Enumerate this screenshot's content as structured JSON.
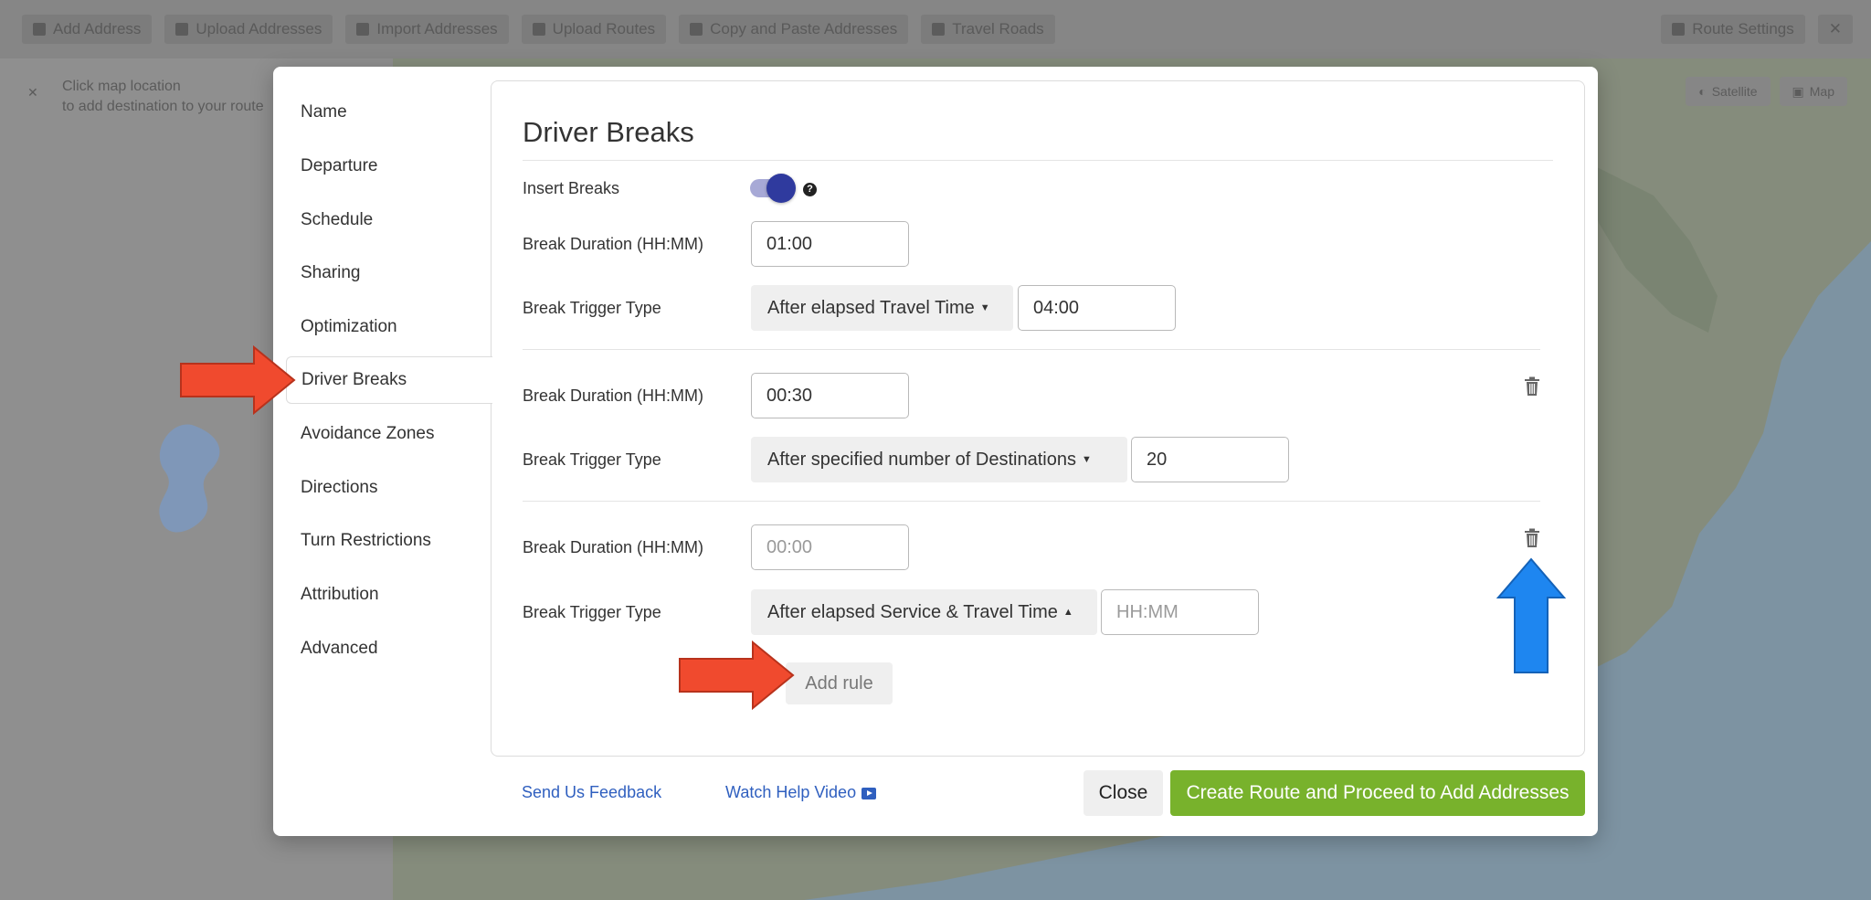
{
  "background": {
    "toolbar_items": [
      "Add Address",
      "Upload Addresses",
      "Import Addresses",
      "Upload Routes",
      "Copy and Paste Addresses",
      "Travel Roads"
    ],
    "toolbar_right": [
      "Route Settings"
    ],
    "hint_line1": "Click map location",
    "hint_line2": "to add destination to your route",
    "map_controls": [
      "Satellite",
      "Map"
    ]
  },
  "nav": {
    "items": [
      {
        "label": "Name"
      },
      {
        "label": "Departure"
      },
      {
        "label": "Schedule"
      },
      {
        "label": "Sharing"
      },
      {
        "label": "Optimization"
      },
      {
        "label": "Driver Breaks"
      },
      {
        "label": "Avoidance Zones"
      },
      {
        "label": "Directions"
      },
      {
        "label": "Turn Restrictions"
      },
      {
        "label": "Attribution"
      },
      {
        "label": "Advanced"
      }
    ],
    "active": "Driver Breaks"
  },
  "panel": {
    "title": "Driver Breaks",
    "insert_breaks_label": "Insert Breaks",
    "insert_breaks_on": true,
    "help_glyph": "?",
    "rules": [
      {
        "duration_label": "Break Duration (HH:MM)",
        "duration_value": "01:00",
        "trigger_label": "Break Trigger Type",
        "trigger_type": "After elapsed Travel Time",
        "trigger_caret": "down",
        "trigger_value": "04:00",
        "trigger_placeholder": ""
      },
      {
        "duration_label": "Break Duration (HH:MM)",
        "duration_value": "00:30",
        "trigger_label": "Break Trigger Type",
        "trigger_type": "After specified number of Destinations",
        "trigger_caret": "down",
        "trigger_value": "20",
        "trigger_placeholder": ""
      },
      {
        "duration_label": "Break Duration (HH:MM)",
        "duration_value": "",
        "duration_placeholder": "00:00",
        "trigger_label": "Break Trigger Type",
        "trigger_type": "After elapsed Service & Travel Time",
        "trigger_caret": "up",
        "trigger_value": "",
        "trigger_placeholder": "HH:MM"
      }
    ],
    "add_rule_label": "Add rule"
  },
  "footer": {
    "feedback_link": "Send Us Feedback",
    "help_video_link": "Watch Help Video",
    "close_label": "Close",
    "create_label": "Create Route and Proceed to Add Addresses"
  },
  "colors": {
    "accent_green": "#78b22c",
    "toggle_knob": "#2f3a9e",
    "link_blue": "#2f5fbf",
    "annotation_red": "#f04a2e",
    "annotation_blue": "#1e86f0"
  }
}
